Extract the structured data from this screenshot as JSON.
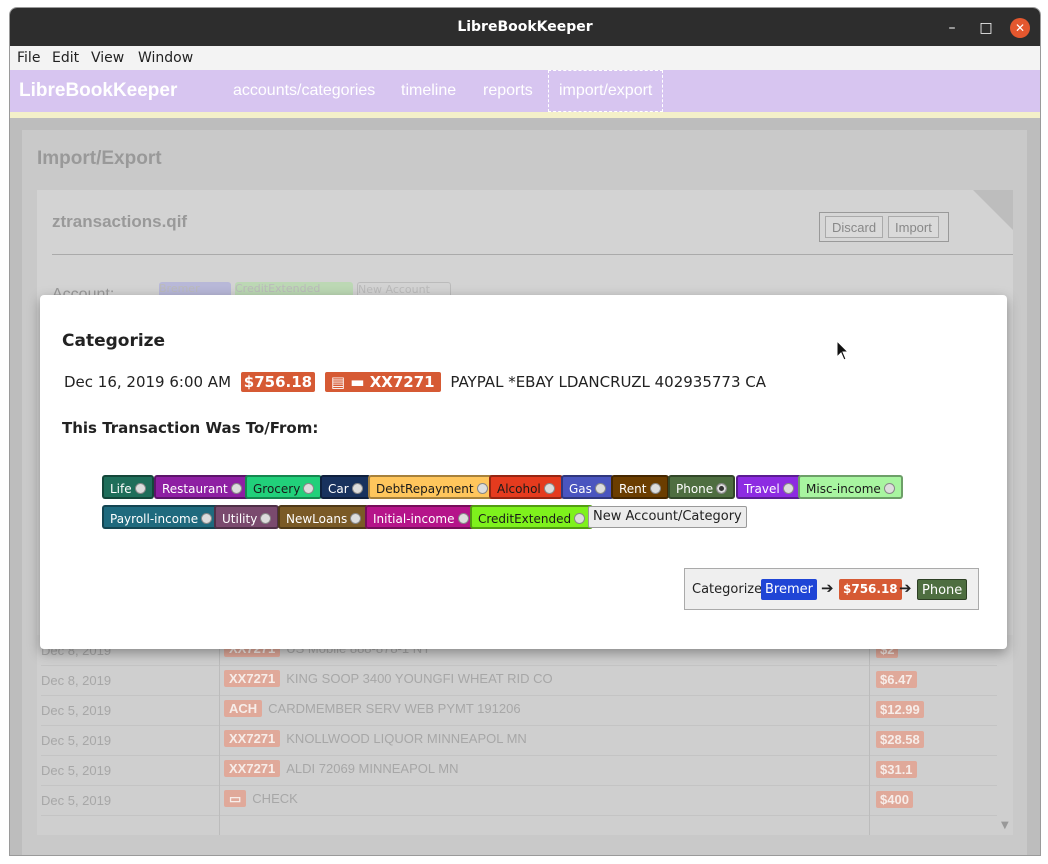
{
  "window": {
    "title": "LibreBookKeeper",
    "controls": [
      "–",
      "□",
      "✕"
    ]
  },
  "menubar": [
    "File",
    "Edit",
    "View",
    "Window"
  ],
  "app": {
    "brand": "LibreBookKeeper",
    "nav": [
      "accounts/categories",
      "timeline",
      "reports",
      "import/export"
    ]
  },
  "page": {
    "title": "Import/Export",
    "file_name": "ztransactions.qif",
    "discard_label": "Discard",
    "import_label": "Import",
    "account_label": "Account:",
    "faded_accounts": [
      "Bremer",
      "CreditExtended",
      "New Account"
    ]
  },
  "transactions": [
    {
      "date": "Dec 8, 2019",
      "tag": "XX7271",
      "desc": "US Mobile 888-878-1 NY",
      "amount": "$2"
    },
    {
      "date": "Dec 8, 2019",
      "tag": "XX7271",
      "desc": "KING SOOP 3400 YOUNGFI WHEAT RID CO",
      "amount": "$6.47"
    },
    {
      "date": "Dec 5, 2019",
      "tag": "ACH",
      "desc": "CARDMEMBER SERV WEB PYMT 191206",
      "amount": "$12.99"
    },
    {
      "date": "Dec 5, 2019",
      "tag": "XX7271",
      "desc": "KNOLLWOOD LIQUOR MINNEAPOL MN",
      "amount": "$28.58"
    },
    {
      "date": "Dec 5, 2019",
      "tag": "XX7271",
      "desc": "ALDI 72069 MINNEAPOL MN",
      "amount": "$31.1"
    },
    {
      "date": "Dec 5, 2019",
      "tag": "",
      "desc": "CHECK",
      "amount": "$400"
    }
  ],
  "modal": {
    "title": "Categorize",
    "tx_date": "Dec 16, 2019 6:00 AM",
    "tx_amount": "$756.18",
    "tx_card": "XX7271",
    "tx_desc": "PAYPAL *EBAY LDANCRUZL 402935773 CA",
    "subtitle": "This Transaction Was To/From:",
    "categories": [
      {
        "name": "Life",
        "color": "#1f6e5a",
        "text": "#ffffff"
      },
      {
        "name": "Restaurant",
        "color": "#8e1fa3",
        "text": "#ffffff"
      },
      {
        "name": "Grocery",
        "color": "#21d07a",
        "text": "#1a1a1a"
      },
      {
        "name": "Car",
        "color": "#18325e",
        "text": "#ffffff"
      },
      {
        "name": "DebtRepayment",
        "color": "#ffc65c",
        "text": "#1a1a1a"
      },
      {
        "name": "Alcohol",
        "color": "#e53b1e",
        "text": "#1a1a1a"
      },
      {
        "name": "Gas",
        "color": "#4a55bf",
        "text": "#ffffff"
      },
      {
        "name": "Rent",
        "color": "#6b3d00",
        "text": "#ffffff"
      },
      {
        "name": "Phone",
        "color": "#4e6e40",
        "text": "#ffffff"
      },
      {
        "name": "Travel",
        "color": "#8d2be2",
        "text": "#ffffff"
      },
      {
        "name": "Misc-income",
        "color": "#a8f5a0",
        "text": "#1a1a1a"
      },
      {
        "name": "Payroll-income",
        "color": "#1f6a7e",
        "text": "#ffffff"
      },
      {
        "name": "Utility",
        "color": "#7a4a6e",
        "text": "#ffffff"
      },
      {
        "name": "NewLoans",
        "color": "#7a5a26",
        "text": "#ffffff"
      },
      {
        "name": "Initial-income",
        "color": "#b5148a",
        "text": "#ffffff"
      },
      {
        "name": "CreditExtended",
        "color": "#7ef21c",
        "text": "#1a1a1a"
      }
    ],
    "selected_category": "Phone",
    "new_account_label": "New Account/Category",
    "categorize_label": "Categorize",
    "from_account": "Bremer",
    "from_color": "#1f45d6",
    "arrow": "➔",
    "to_category": "Phone"
  }
}
